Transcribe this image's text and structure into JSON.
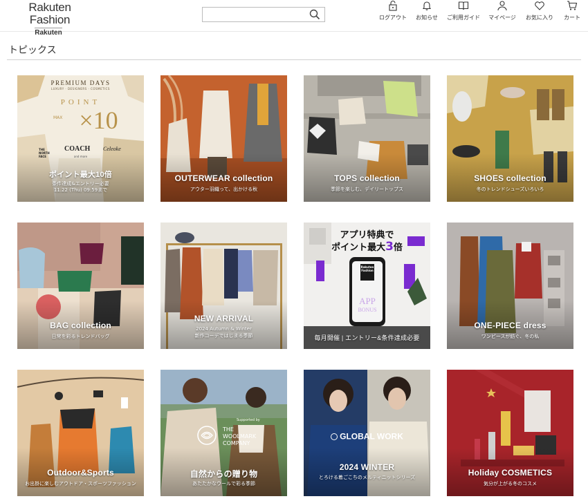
{
  "header": {
    "logo_main": "Rakuten Fashion",
    "logo_sub": "Rakuten",
    "search_placeholder": "",
    "nav": [
      {
        "label": "ログアウト",
        "icon": "lock-icon"
      },
      {
        "label": "お知らせ",
        "icon": "bell-icon"
      },
      {
        "label": "ご利用ガイド",
        "icon": "book-icon"
      },
      {
        "label": "マイページ",
        "icon": "user-icon"
      },
      {
        "label": "お気に入り",
        "icon": "heart-icon"
      },
      {
        "label": "カート",
        "icon": "cart-icon"
      }
    ]
  },
  "section": {
    "title": "トピックス"
  },
  "tiles": [
    {
      "key": "premium",
      "top_small": "PREMIUM DAYS",
      "top_tiny": "LUXURY · DESIGNERS · COSMETICS",
      "point_word": "POINT",
      "max_word": "MAX",
      "times": "×10",
      "brands": [
        "THE NORTH FACE",
        "COACH",
        "Celeoke"
      ],
      "and_more": "and more",
      "title": "ポイント最大10倍",
      "sub1": "条件達成&エントリー必要",
      "sub2": "11.22 (Thu) 09:59まで",
      "bg": "#f3ede0"
    },
    {
      "key": "outerwear",
      "title": "OUTERWEAR collection",
      "sub1": "アウター羽織って、出かける秋",
      "bg": "#c4622e"
    },
    {
      "key": "tops",
      "title": "TOPS collection",
      "sub1": "季節を楽しむ、デイリートップス",
      "bg": "#b9b5ac"
    },
    {
      "key": "shoes",
      "title": "SHOES collection",
      "sub1": "冬のトレンドシューズいろいろ",
      "bg": "#c8a24a"
    },
    {
      "key": "bag",
      "title": "BAG collection",
      "sub1": "日常を彩るトレンドバッグ",
      "bg": "#cba593"
    },
    {
      "key": "newarrival",
      "title": "NEW ARRIVAL",
      "sub1": "2024 Autumn & Winter",
      "sub2": "新作コーデではじまる季節",
      "bg": "#e9e6df"
    },
    {
      "key": "app",
      "headline1": "アプリ特典で",
      "headline2a": "ポイント最大",
      "headline2b": "3",
      "headline2c": "倍",
      "phone_brand": "Rakuten Fashion",
      "phone_bonus1": "APP",
      "phone_bonus2": "BONUS",
      "title": "毎月開催 | エントリー&条件達成必要",
      "bg": "#f1f0ee"
    },
    {
      "key": "onepiece",
      "title": "ONE-PIECE dress",
      "sub1": "ワンピースが紡ぐ、冬の私",
      "bg": "#b9b4b1"
    },
    {
      "key": "outdoor",
      "title": "Outdoor&Sports",
      "sub1": "お出掛に楽しむアウトドア・スポーツファッション",
      "bg": "#e3c9a5"
    },
    {
      "key": "woolmark",
      "supported_by": "Supported by",
      "wool_line1": "THE",
      "wool_line2": "WOOLMARK",
      "wool_line3": "COMPANY",
      "title": "自然からの贈り物",
      "sub1": "あたたかなウールで彩る季節",
      "bg": "#6b8f5a"
    },
    {
      "key": "globalwork",
      "brand": "GLOBAL WORK",
      "title": "2024 WINTER",
      "sub1": "とろける着ごこちのメルティニットシリーズ",
      "bg": "#243c66"
    },
    {
      "key": "holiday",
      "title": "Holiday COSMETICS",
      "sub1": "気分が上がる冬のコスメ",
      "bg": "#a8242a"
    }
  ],
  "colors": {
    "text": "#333333",
    "rule": "#cfcfcf",
    "app_purple": "#7a2bd0"
  }
}
